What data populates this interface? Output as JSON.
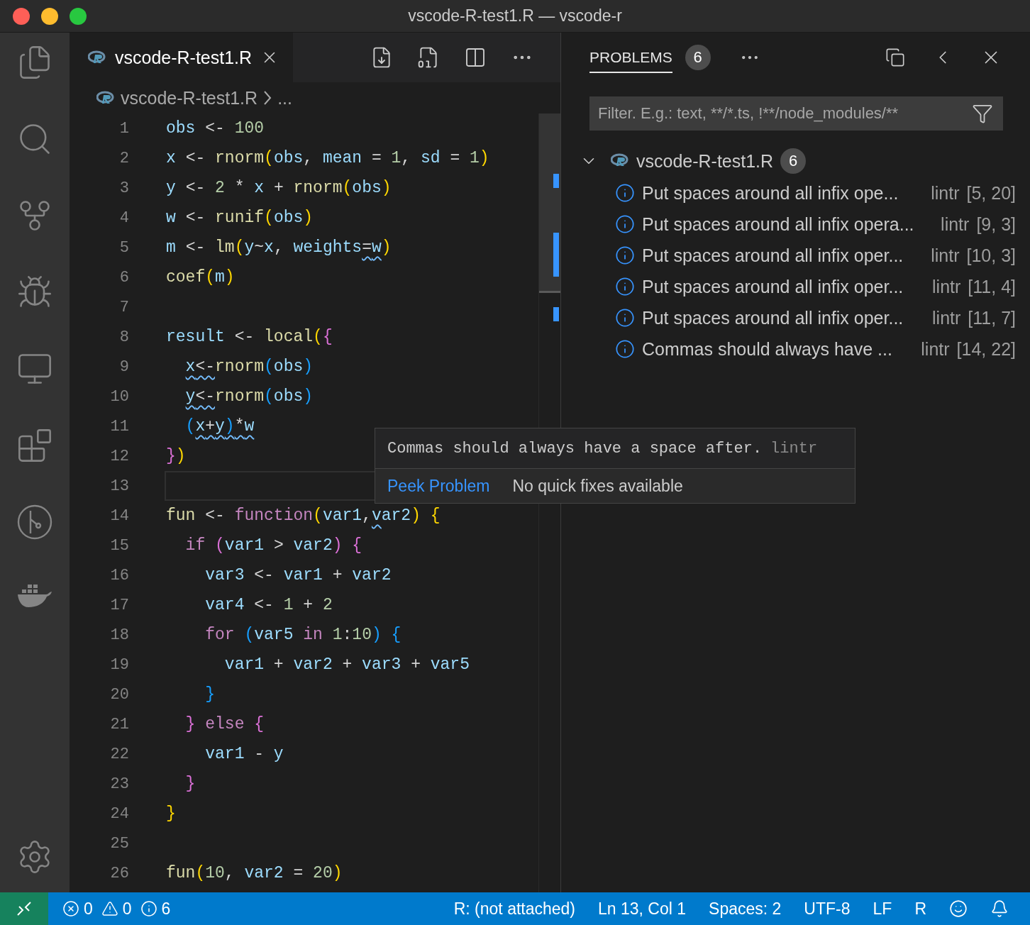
{
  "window": {
    "title": "vscode-R-test1.R — vscode-r"
  },
  "editor": {
    "tab": {
      "label": "vscode-R-test1.R",
      "selected": true
    },
    "breadcrumbs": [
      "vscode-R-test1.R",
      "..."
    ],
    "lines": [
      {
        "number": "1",
        "current": false,
        "tokens": [
          {
            "text": "obs",
            "kind": "var"
          },
          {
            "text": " <- ",
            "kind": "op"
          },
          {
            "text": "100",
            "kind": "num"
          }
        ]
      },
      {
        "number": "2",
        "current": false,
        "tokens": [
          {
            "text": "x",
            "kind": "var"
          },
          {
            "text": " <- ",
            "kind": "op"
          },
          {
            "text": "rnorm",
            "kind": "fn"
          },
          {
            "text": "(",
            "kind": "p1"
          },
          {
            "text": "obs",
            "kind": "var"
          },
          {
            "text": ", ",
            "kind": "op"
          },
          {
            "text": "mean",
            "kind": "var"
          },
          {
            "text": " = ",
            "kind": "op"
          },
          {
            "text": "1",
            "kind": "num"
          },
          {
            "text": ", ",
            "kind": "op"
          },
          {
            "text": "sd",
            "kind": "var"
          },
          {
            "text": " = ",
            "kind": "op"
          },
          {
            "text": "1",
            "kind": "num"
          },
          {
            "text": ")",
            "kind": "p1"
          }
        ]
      },
      {
        "number": "3",
        "current": false,
        "tokens": [
          {
            "text": "y",
            "kind": "var"
          },
          {
            "text": " <- ",
            "kind": "op"
          },
          {
            "text": "2",
            "kind": "num"
          },
          {
            "text": " * ",
            "kind": "op"
          },
          {
            "text": "x",
            "kind": "var"
          },
          {
            "text": " + ",
            "kind": "op"
          },
          {
            "text": "rnorm",
            "kind": "fn"
          },
          {
            "text": "(",
            "kind": "p1"
          },
          {
            "text": "obs",
            "kind": "var"
          },
          {
            "text": ")",
            "kind": "p1"
          }
        ]
      },
      {
        "number": "4",
        "current": false,
        "tokens": [
          {
            "text": "w",
            "kind": "var"
          },
          {
            "text": " <- ",
            "kind": "op"
          },
          {
            "text": "runif",
            "kind": "fn"
          },
          {
            "text": "(",
            "kind": "p1"
          },
          {
            "text": "obs",
            "kind": "var"
          },
          {
            "text": ")",
            "kind": "p1"
          }
        ]
      },
      {
        "number": "5",
        "current": false,
        "tokens": [
          {
            "text": "m",
            "kind": "var"
          },
          {
            "text": " <- ",
            "kind": "op"
          },
          {
            "text": "lm",
            "kind": "fn"
          },
          {
            "text": "(",
            "kind": "p1"
          },
          {
            "text": "y",
            "kind": "var"
          },
          {
            "text": "~",
            "kind": "op"
          },
          {
            "text": "x",
            "kind": "var"
          },
          {
            "text": ", ",
            "kind": "op"
          },
          {
            "text": "weights",
            "kind": "var"
          },
          {
            "text": "=",
            "kind": "op",
            "squiggle": true
          },
          {
            "text": "w",
            "kind": "var",
            "squiggle": true
          },
          {
            "text": ")",
            "kind": "p1"
          }
        ]
      },
      {
        "number": "6",
        "current": false,
        "tokens": [
          {
            "text": "coef",
            "kind": "fn"
          },
          {
            "text": "(",
            "kind": "p1"
          },
          {
            "text": "m",
            "kind": "var"
          },
          {
            "text": ")",
            "kind": "p1"
          }
        ]
      },
      {
        "number": "7",
        "current": false
      },
      {
        "number": "8",
        "current": false,
        "tokens": [
          {
            "text": "result",
            "kind": "var"
          },
          {
            "text": " <- ",
            "kind": "op"
          },
          {
            "text": "local",
            "kind": "fn"
          },
          {
            "text": "(",
            "kind": "p1"
          },
          {
            "text": "{",
            "kind": "p2"
          }
        ]
      },
      {
        "number": "9",
        "current": false,
        "tokens": [
          {
            "text": "  x",
            "kind": "var",
            "squiggle": true
          },
          {
            "text": "<-",
            "kind": "op",
            "squiggle": true
          },
          {
            "text": "rnorm",
            "kind": "fn"
          },
          {
            "text": "(",
            "kind": "p3"
          },
          {
            "text": "obs",
            "kind": "var"
          },
          {
            "text": ")",
            "kind": "p3"
          }
        ]
      },
      {
        "number": "10",
        "current": false,
        "tokens": [
          {
            "text": "  y",
            "kind": "var",
            "squiggle": true
          },
          {
            "text": "<-",
            "kind": "op",
            "squiggle": true
          },
          {
            "text": "rnorm",
            "kind": "fn"
          },
          {
            "text": "(",
            "kind": "p3"
          },
          {
            "text": "obs",
            "kind": "var"
          },
          {
            "text": ")",
            "kind": "p3"
          }
        ]
      },
      {
        "number": "11",
        "current": false,
        "tokens": [
          {
            "text": "  (",
            "kind": "p3"
          },
          {
            "text": "x",
            "kind": "var",
            "squiggle": true
          },
          {
            "text": "+",
            "kind": "op",
            "squiggle": true
          },
          {
            "text": "y",
            "kind": "var",
            "squiggle": true
          },
          {
            "text": ")",
            "kind": "p3",
            "squiggle": true
          },
          {
            "text": "*",
            "kind": "op",
            "squiggle": true
          },
          {
            "text": "w",
            "kind": "var",
            "squiggle": true
          }
        ]
      },
      {
        "number": "12",
        "current": false,
        "tokens": [
          {
            "text": "}",
            "kind": "p2"
          },
          {
            "text": ")",
            "kind": "p1"
          }
        ]
      },
      {
        "number": "13",
        "current": true
      },
      {
        "number": "14",
        "current": false,
        "tokens": [
          {
            "text": "fun",
            "kind": "fn"
          },
          {
            "text": " <- ",
            "kind": "op"
          },
          {
            "text": "function",
            "kind": "kw"
          },
          {
            "text": "(",
            "kind": "p1"
          },
          {
            "text": "var1",
            "kind": "var"
          },
          {
            "text": ",",
            "kind": "op"
          },
          {
            "text": "v",
            "kind": "var",
            "squiggle": true
          },
          {
            "text": "ar2",
            "kind": "var"
          },
          {
            "text": ")",
            "kind": "p1"
          },
          {
            "text": " {",
            "kind": "p1"
          }
        ]
      },
      {
        "number": "15",
        "current": false,
        "tokens": [
          {
            "text": "  if",
            "kind": "kw"
          },
          {
            "text": " (",
            "kind": "p2"
          },
          {
            "text": "var1",
            "kind": "var"
          },
          {
            "text": " > ",
            "kind": "op"
          },
          {
            "text": "var2",
            "kind": "var"
          },
          {
            "text": ")",
            "kind": "p2"
          },
          {
            "text": " {",
            "kind": "p2"
          }
        ]
      },
      {
        "number": "16",
        "current": false,
        "tokens": [
          {
            "text": "    var3",
            "kind": "var"
          },
          {
            "text": " <- ",
            "kind": "op"
          },
          {
            "text": "var1",
            "kind": "var"
          },
          {
            "text": " + ",
            "kind": "op"
          },
          {
            "text": "var2",
            "kind": "var"
          }
        ]
      },
      {
        "number": "17",
        "current": false,
        "tokens": [
          {
            "text": "    var4",
            "kind": "var"
          },
          {
            "text": " <- ",
            "kind": "op"
          },
          {
            "text": "1",
            "kind": "num"
          },
          {
            "text": " + ",
            "kind": "op"
          },
          {
            "text": "2",
            "kind": "num"
          }
        ]
      },
      {
        "number": "18",
        "current": false,
        "tokens": [
          {
            "text": "    for",
            "kind": "kw"
          },
          {
            "text": " (",
            "kind": "p3"
          },
          {
            "text": "var5",
            "kind": "var"
          },
          {
            "text": " in",
            "kind": "kw"
          },
          {
            "text": " 1",
            "kind": "num"
          },
          {
            "text": ":",
            "kind": "op"
          },
          {
            "text": "10",
            "kind": "num"
          },
          {
            "text": ")",
            "kind": "p3"
          },
          {
            "text": " {",
            "kind": "p3"
          }
        ]
      },
      {
        "number": "19",
        "current": false,
        "tokens": [
          {
            "text": "      var1",
            "kind": "var"
          },
          {
            "text": " + ",
            "kind": "op"
          },
          {
            "text": "var2",
            "kind": "var"
          },
          {
            "text": " + ",
            "kind": "op"
          },
          {
            "text": "var3",
            "kind": "var"
          },
          {
            "text": " + ",
            "kind": "op"
          },
          {
            "text": "var5",
            "kind": "var"
          }
        ]
      },
      {
        "number": "20",
        "current": false,
        "tokens": [
          {
            "text": "    }",
            "kind": "p3"
          }
        ]
      },
      {
        "number": "21",
        "current": false,
        "tokens": [
          {
            "text": "  }",
            "kind": "p2"
          },
          {
            "text": " else",
            "kind": "kw"
          },
          {
            "text": " {",
            "kind": "p2"
          }
        ]
      },
      {
        "number": "22",
        "current": false,
        "tokens": [
          {
            "text": "    var1",
            "kind": "var"
          },
          {
            "text": " - ",
            "kind": "op"
          },
          {
            "text": "y",
            "kind": "var"
          }
        ]
      },
      {
        "number": "23",
        "current": false,
        "tokens": [
          {
            "text": "  }",
            "kind": "p2"
          }
        ]
      },
      {
        "number": "24",
        "current": false,
        "tokens": [
          {
            "text": "}",
            "kind": "p1"
          }
        ]
      },
      {
        "number": "25",
        "current": false
      },
      {
        "number": "26",
        "current": false,
        "tokens": [
          {
            "text": "fun",
            "kind": "fn"
          },
          {
            "text": "(",
            "kind": "p1"
          },
          {
            "text": "10",
            "kind": "num"
          },
          {
            "text": ", ",
            "kind": "op"
          },
          {
            "text": "var2",
            "kind": "var"
          },
          {
            "text": " = ",
            "kind": "op"
          },
          {
            "text": "20",
            "kind": "num"
          },
          {
            "text": ")",
            "kind": "p1"
          }
        ]
      }
    ]
  },
  "hover": {
    "message": "Commas should always have a space after.",
    "source": "lintr",
    "action": "Peek Problem",
    "note": "No quick fixes available"
  },
  "panel": {
    "tab": {
      "label": "PROBLEMS",
      "badge": "6",
      "selected": true
    },
    "filter": {
      "placeholder": "Filter. E.g.: text, **/*.ts, !**/node_modules/**"
    },
    "file": {
      "name": "vscode-R-test1.R",
      "count": "6",
      "expanded": true
    },
    "problems": [
      {
        "message": "Put spaces around all infix ope...",
        "source": "lintr",
        "location": "[5, 20]"
      },
      {
        "message": "Put spaces around all infix opera...",
        "source": "lintr",
        "location": "[9, 3]"
      },
      {
        "message": "Put spaces around all infix oper...",
        "source": "lintr",
        "location": "[10, 3]"
      },
      {
        "message": "Put spaces around all infix oper...",
        "source": "lintr",
        "location": "[11, 4]"
      },
      {
        "message": "Put spaces around all infix oper...",
        "source": "lintr",
        "location": "[11, 7]"
      },
      {
        "message": "Commas should always have ...",
        "source": "lintr",
        "location": "[14, 22]"
      }
    ]
  },
  "status_bar": {
    "errors": "0",
    "warnings": "0",
    "infos": "6",
    "items": [
      "R: (not attached)",
      "Ln 13, Col 1",
      "Spaces: 2",
      "UTF-8",
      "LF",
      "R"
    ]
  }
}
